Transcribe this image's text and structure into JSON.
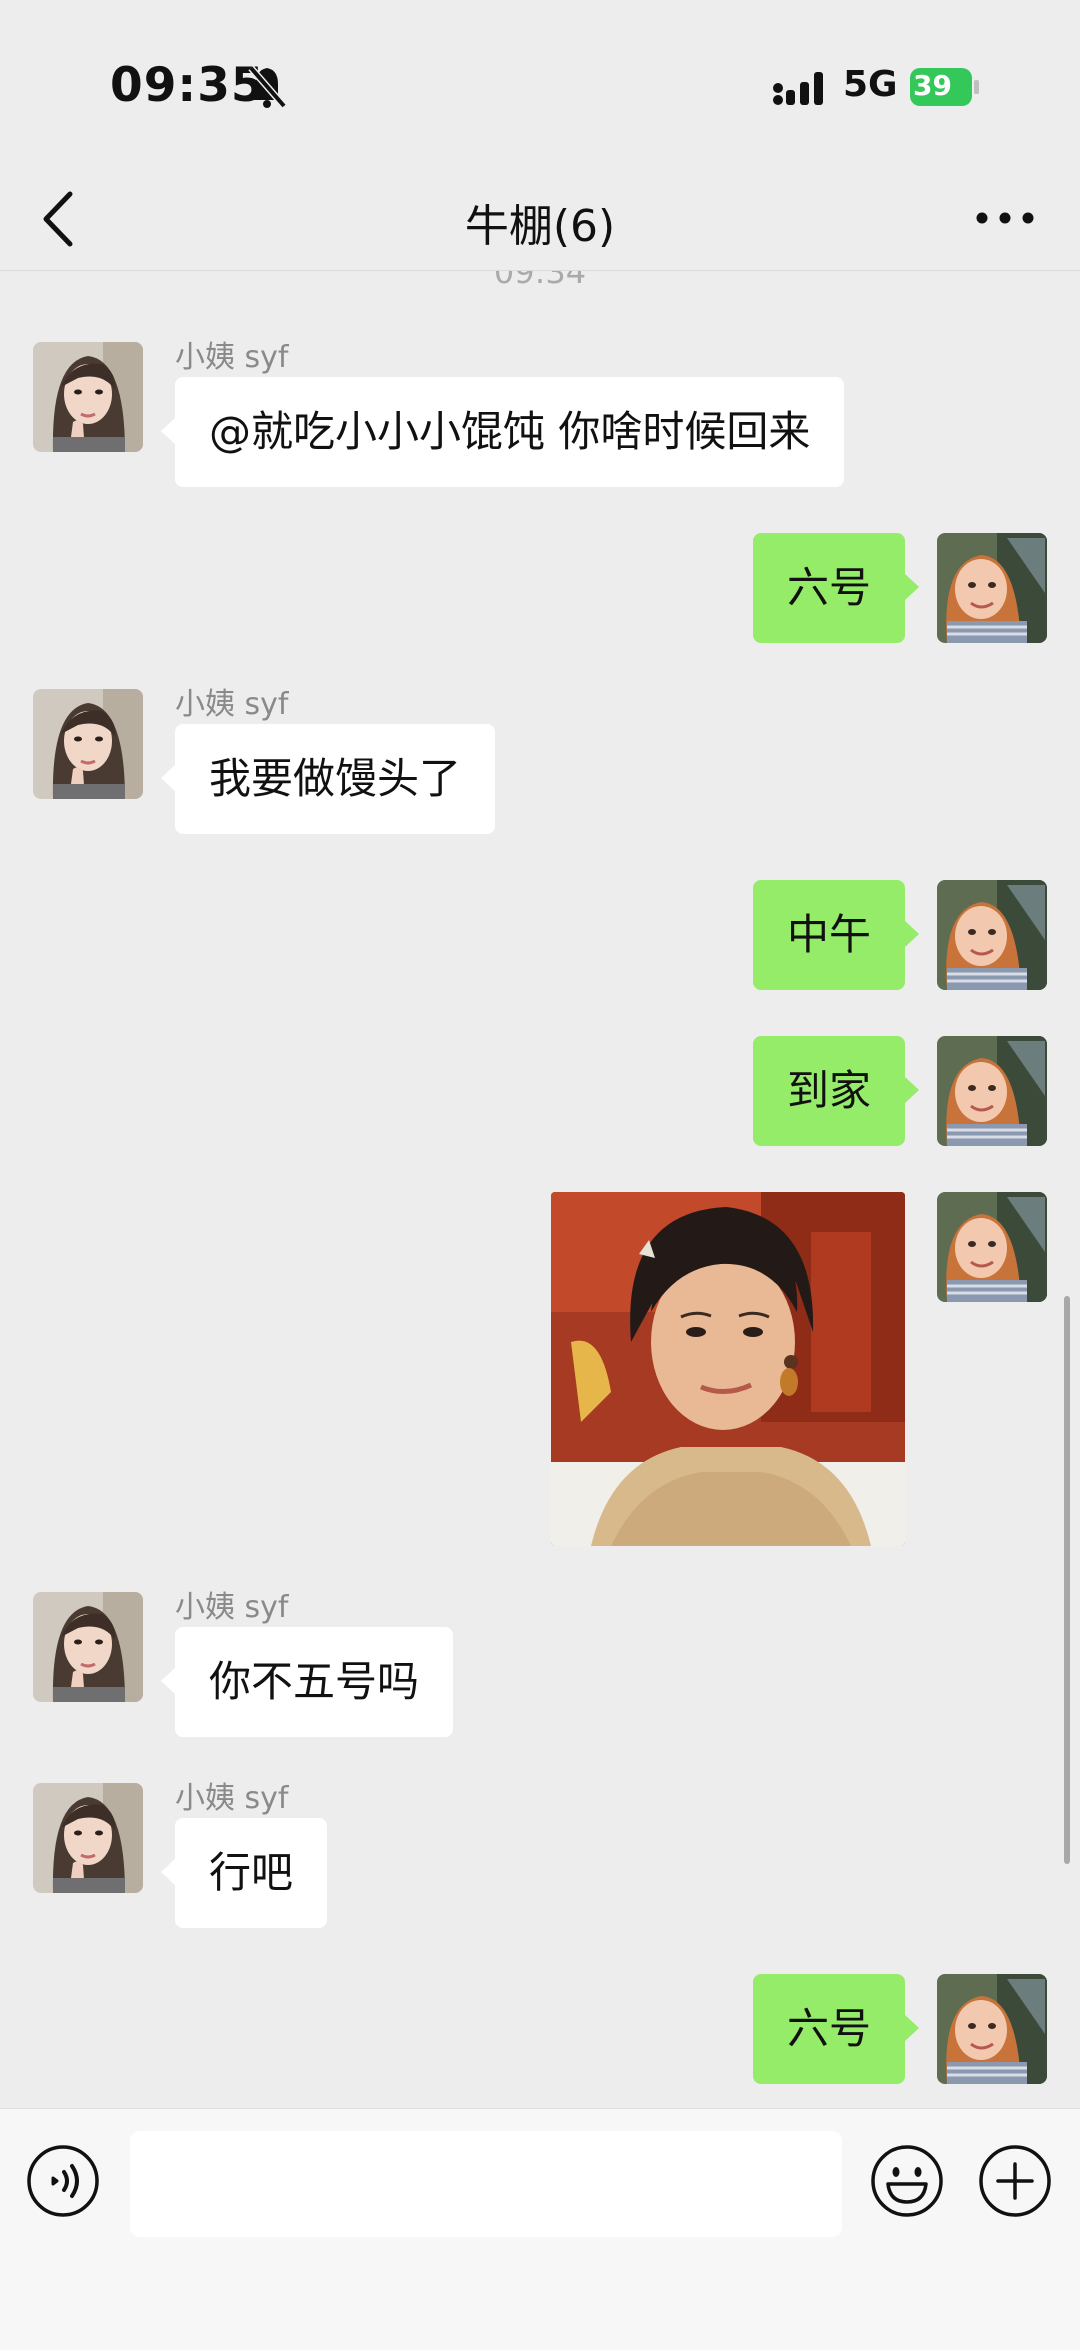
{
  "status_bar": {
    "time": "09:35",
    "network": "5G",
    "battery": "39"
  },
  "header": {
    "title": "牛棚(6)"
  },
  "chat": {
    "timestamp": "09:34",
    "messages": [
      {
        "sender": "小姨 syf",
        "text": "@就吃小小小馄饨 你啥时候回来"
      },
      {
        "text": "六号"
      },
      {
        "sender": "小姨 syf",
        "text": "我要做馒头了"
      },
      {
        "text": "中午"
      },
      {
        "text": "到家"
      },
      {
        "type": "image"
      },
      {
        "sender": "小姨 syf",
        "text": "你不五号吗"
      },
      {
        "sender": "小姨 syf",
        "text": "行吧"
      },
      {
        "text": "六号"
      }
    ]
  },
  "input_bar": {
    "placeholder": ""
  },
  "colors": {
    "self_bubble": "#95ec69",
    "other_bubble": "#ffffff",
    "background": "#ededed",
    "battery": "#34c759"
  },
  "icons": [
    "back-icon",
    "more-icon",
    "voice-icon",
    "emoji-icon",
    "plus-icon",
    "bell-muted-icon",
    "signal-icon",
    "battery-icon"
  ]
}
